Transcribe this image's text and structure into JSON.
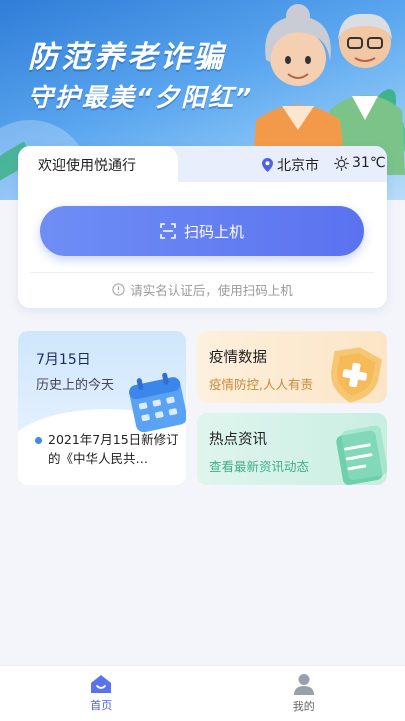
{
  "banner": {
    "title": "防范养老诈骗",
    "subtitle": "守护最美“夕阳红”"
  },
  "main_card": {
    "welcome": "欢迎使用悦通行",
    "location": "北京市",
    "temperature": "31℃",
    "scan_button": "扫码上机",
    "hint": "请实名认证后，使用扫码上机"
  },
  "history_card": {
    "date": "7月15日",
    "subtitle": "历史上的今天",
    "item": "2021年7月15日新修订的《中华人民共…"
  },
  "epidemic_card": {
    "title": "疫情数据",
    "subtitle": "疫情防控,人人有责"
  },
  "news_card": {
    "title": "热点资讯",
    "subtitle": "查看最新资讯动态"
  },
  "bottom_nav": {
    "items": [
      {
        "label": "首页",
        "icon": "home-icon",
        "active": true
      },
      {
        "label": "我的",
        "icon": "user-icon",
        "active": false
      }
    ]
  },
  "colors": {
    "accent": "#5b72ef",
    "banner": "#4a95e6",
    "epidemic": "#c98a3a",
    "news": "#3fae88"
  }
}
